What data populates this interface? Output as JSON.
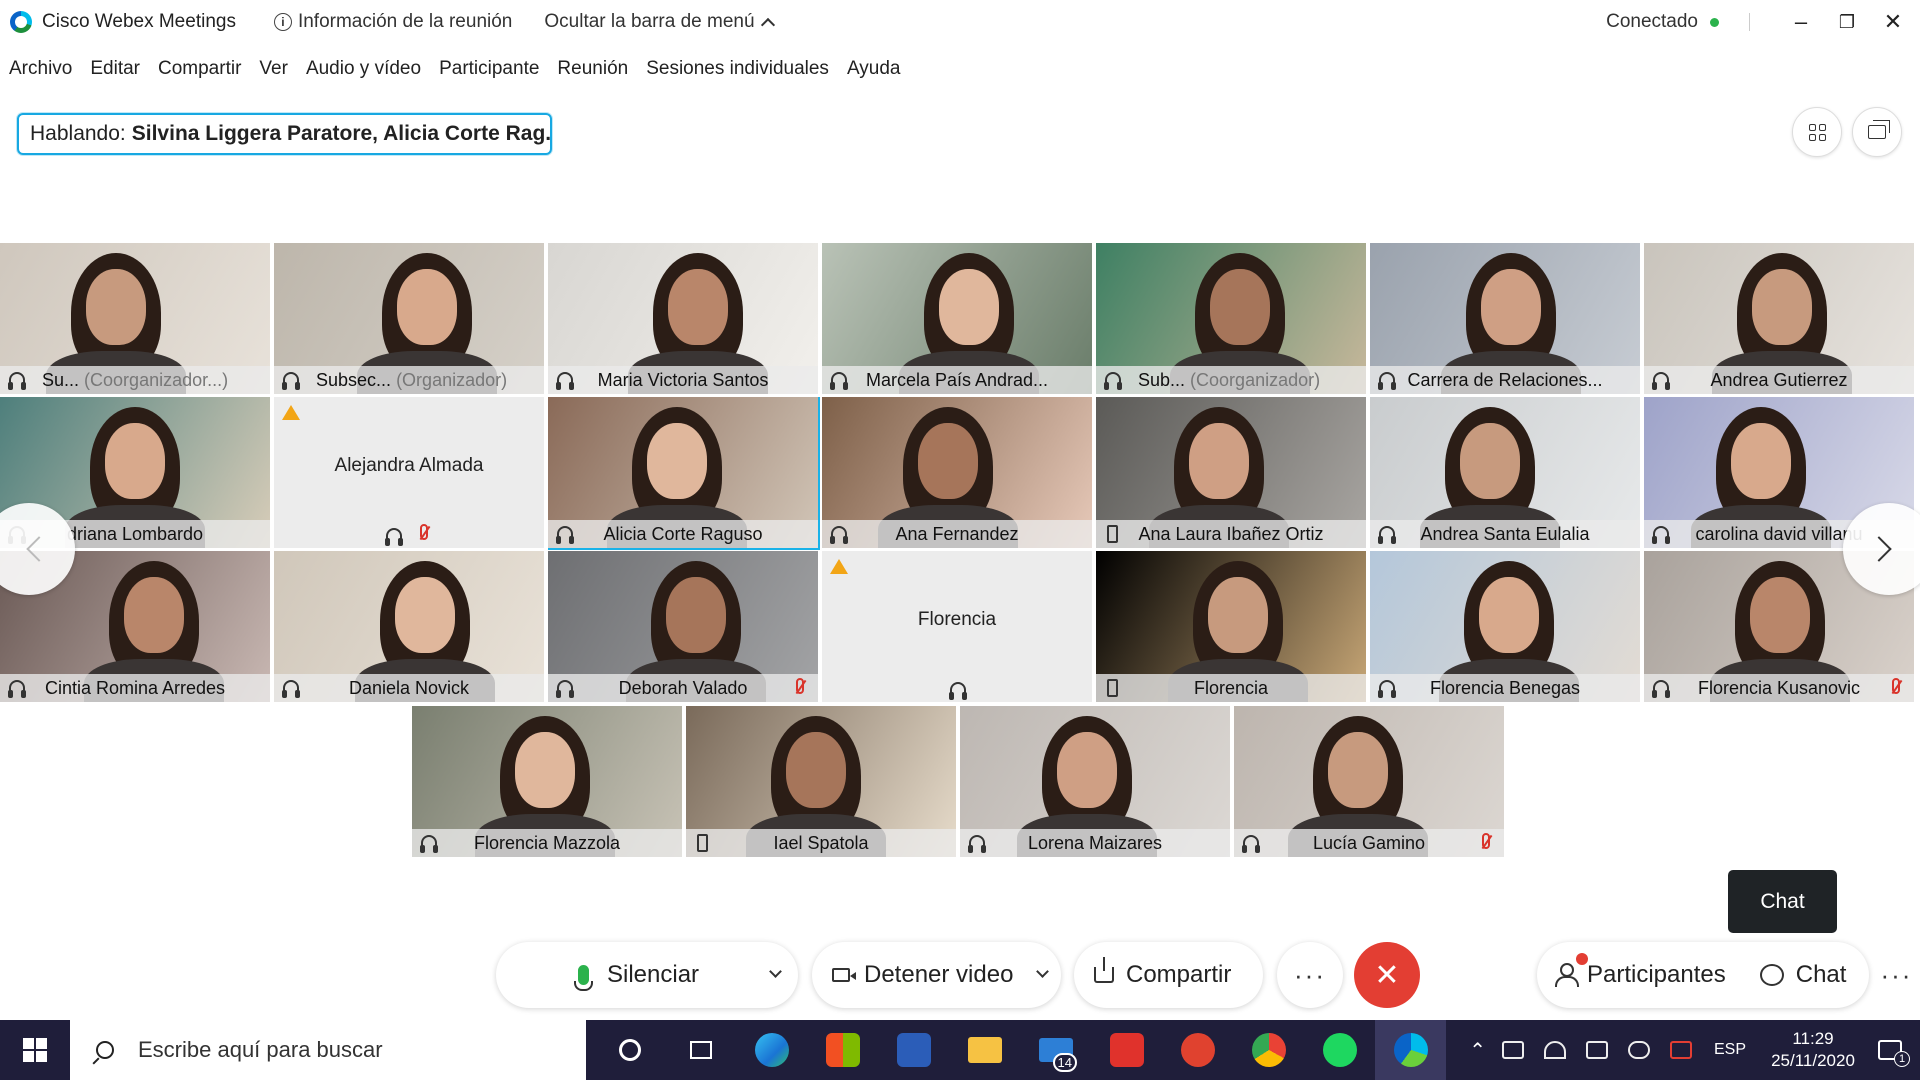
{
  "app": {
    "title": "Cisco Webex Meetings",
    "info_label": "Información de la reunión",
    "hide_menu_label": "Ocultar la barra de menú",
    "status": "Conectado"
  },
  "menu": [
    "Archivo",
    "Editar",
    "Compartir",
    "Ver",
    "Audio y vídeo",
    "Participante",
    "Reunión",
    "Sesiones individuales",
    "Ayuda"
  ],
  "speaking": {
    "prefix": "Hablando:",
    "names": "Silvina Liggera Paratore, Alicia Corte Rag..."
  },
  "participants": [
    {
      "name": "Su...",
      "role": "(Coorganizador...)",
      "audio": "headset"
    },
    {
      "name": "Subsec...",
      "role": "(Organizador)",
      "audio": "headset"
    },
    {
      "name": "Maria Victoria Santos",
      "audio": "headset"
    },
    {
      "name": "Marcela País Andrad...",
      "audio": "headset"
    },
    {
      "name": "Sub...",
      "role": "(Coorganizador)",
      "audio": "headset"
    },
    {
      "name": "Carrera de Relaciones...",
      "audio": "headset"
    },
    {
      "name": "Andrea Gutierrez",
      "audio": "headset-loading"
    },
    {
      "name": "driana Lombardo",
      "audio": "headset"
    },
    {
      "name": "Alejandra Almada",
      "audio": "headset",
      "muted": true,
      "no_video": true,
      "warning": true
    },
    {
      "name": "Alicia Corte Raguso",
      "audio": "headset",
      "selected": true
    },
    {
      "name": "Ana Fernandez",
      "audio": "headset"
    },
    {
      "name": "Ana Laura Ibañez Ortiz",
      "audio": "phone"
    },
    {
      "name": "Andrea Santa Eulalia",
      "audio": "headset"
    },
    {
      "name": "carolina david villanu",
      "audio": "headset"
    },
    {
      "name": "Cintia Romina Arredes",
      "audio": "headset"
    },
    {
      "name": "Daniela Novick",
      "audio": "headset"
    },
    {
      "name": "Deborah Valado",
      "audio": "headset",
      "muted": true
    },
    {
      "name": "Florencia",
      "audio": "headset",
      "no_video": true,
      "warning": true
    },
    {
      "name": "Florencia",
      "audio": "phone"
    },
    {
      "name": "Florencia Benegas",
      "audio": "headset"
    },
    {
      "name": "Florencia Kusanovic",
      "audio": "headset",
      "muted": true
    },
    {
      "name": "Florencia Mazzola",
      "audio": "headset"
    },
    {
      "name": "Iael Spatola",
      "audio": "phone"
    },
    {
      "name": "Lorena Maizares",
      "audio": "headset"
    },
    {
      "name": "Lucía Gamino",
      "audio": "headset",
      "muted": true
    }
  ],
  "controls": {
    "mute": "Silenciar",
    "stop_video": "Detener video",
    "share": "Compartir",
    "participants": "Participantes",
    "chat": "Chat",
    "tooltip": "Chat",
    "more": "···",
    "end": "✕"
  },
  "taskbar": {
    "search_placeholder": "Escribe aquí para buscar",
    "mail_badge": "14",
    "lang": "ESP",
    "time": "11:29",
    "date": "25/11/2020",
    "notif_count": "1"
  },
  "colors": {
    "accent": "#19b2e8",
    "end_call": "#e33e33",
    "status_ok": "#2bb24c",
    "taskbar": "#1f1e3a"
  }
}
